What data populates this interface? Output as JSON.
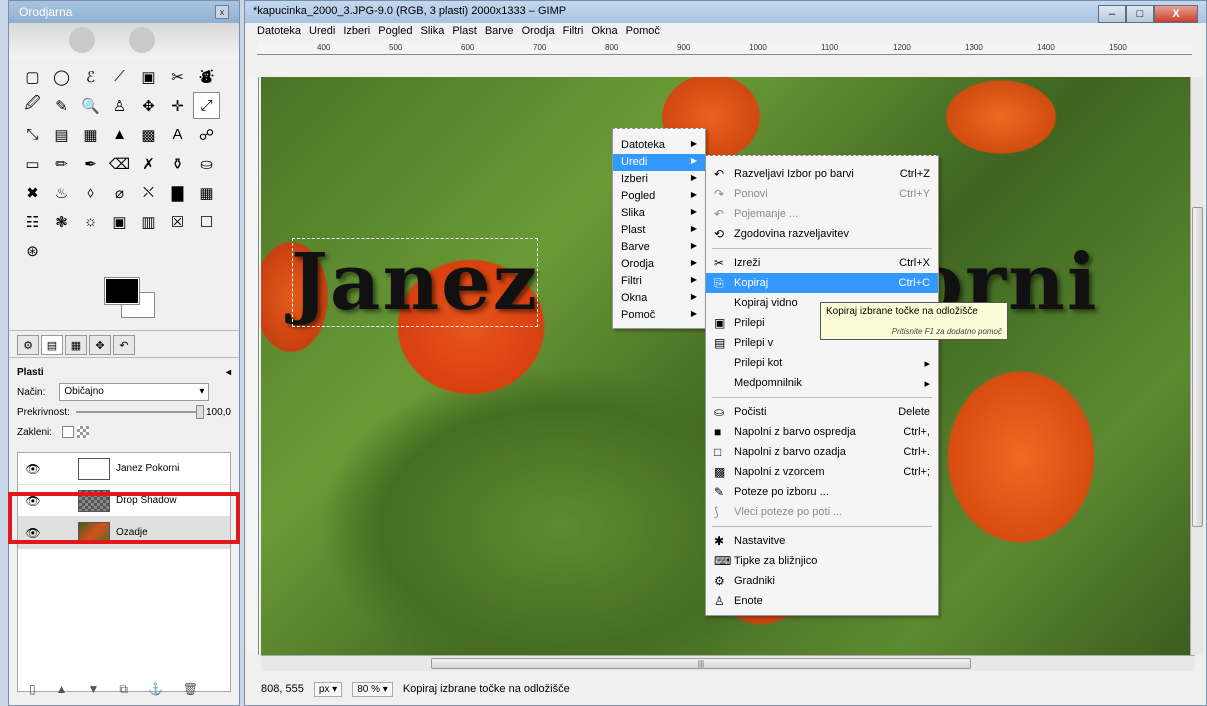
{
  "toolbox": {
    "title": "Orodjarna",
    "close_label": "x",
    "tools": [
      "▢",
      "◯",
      "ℰ",
      "⟋",
      "▣",
      "✂",
      "⛇",
      "🖉",
      "✎",
      "🔍",
      "♙",
      "✥",
      "✛",
      "⤢",
      "⤡",
      "▤",
      "▦",
      "▲",
      "▩",
      "A",
      "☍",
      "▭",
      "✏",
      "✒",
      "⌫",
      "✗",
      "⚱",
      "⛀",
      "✖",
      "♨",
      "⬨",
      "⌀",
      "⛌",
      "▇",
      "▦",
      "☷",
      "❃",
      "☼",
      "▣",
      "▥",
      "☒",
      "☐",
      "⊛"
    ],
    "layers_panel": {
      "title": "Plasti",
      "mode_label": "Način:",
      "mode_value": "Običajno",
      "opacity_label": "Prekrivnost:",
      "opacity_value": "100,0",
      "lock_label": "Zakleni:",
      "layers": [
        {
          "name": "Janez Pokorni"
        },
        {
          "name": "Drop Shadow"
        },
        {
          "name": "Ozadje"
        }
      ]
    }
  },
  "window": {
    "title": "*kapucinka_2000_3.JPG-9.0 (RGB, 3 plasti) 2000x1333 – GIMP",
    "minimize": "–",
    "maximize": "□",
    "close": "X"
  },
  "menubar": [
    "Datoteka",
    "Uredi",
    "Izberi",
    "Pogled",
    "Slika",
    "Plast",
    "Barve",
    "Orodja",
    "Filtri",
    "Okna",
    "Pomoč"
  ],
  "ruler_ticks": [
    "400",
    "500",
    "600",
    "700",
    "800",
    "900",
    "1000",
    "1100",
    "1200",
    "1300",
    "1400",
    "1500"
  ],
  "canvas": {
    "text_left": "Janez",
    "text_right": "orni"
  },
  "context_menu": {
    "items": [
      "Datoteka",
      "Uredi",
      "Izberi",
      "Pogled",
      "Slika",
      "Plast",
      "Barve",
      "Orodja",
      "Filtri",
      "Okna",
      "Pomoč"
    ],
    "highlighted": "Uredi"
  },
  "edit_menu": {
    "items": [
      {
        "icon": "undo-icon",
        "glyph": "↶",
        "label": "Razveljavi Izbor po barvi",
        "shortcut": "Ctrl+Z",
        "state": "normal"
      },
      {
        "icon": "redo-icon",
        "glyph": "↷",
        "label": "Ponovi",
        "shortcut": "Ctrl+Y",
        "state": "disabled"
      },
      {
        "icon": "fade-icon",
        "glyph": "↶",
        "label": "Pojemanje ...",
        "shortcut": "",
        "state": "disabled"
      },
      {
        "icon": "history-icon",
        "glyph": "⟲",
        "label": "Zgodovina razveljavitev",
        "shortcut": "",
        "state": "normal"
      },
      {
        "sep": true
      },
      {
        "icon": "cut-icon",
        "glyph": "✂",
        "label": "Izreži",
        "shortcut": "Ctrl+X",
        "state": "normal"
      },
      {
        "icon": "copy-icon",
        "glyph": "⎘",
        "label": "Kopiraj",
        "shortcut": "Ctrl+C",
        "state": "highlighted"
      },
      {
        "icon": "",
        "glyph": "",
        "label": "Kopiraj vidno",
        "shortcut": "",
        "state": "normal"
      },
      {
        "icon": "paste-icon",
        "glyph": "▣",
        "label": "Prilepi",
        "shortcut": "",
        "state": "normal"
      },
      {
        "icon": "paste-into-icon",
        "glyph": "▤",
        "label": "Prilepi v",
        "shortcut": "",
        "state": "normal"
      },
      {
        "icon": "",
        "glyph": "",
        "label": "Prilepi kot",
        "shortcut": "▸",
        "state": "normal"
      },
      {
        "icon": "",
        "glyph": "",
        "label": "Medpomnilnik",
        "shortcut": "▸",
        "state": "normal"
      },
      {
        "sep": true
      },
      {
        "icon": "clear-icon",
        "glyph": "⛀",
        "label": "Počisti",
        "shortcut": "Delete",
        "state": "normal"
      },
      {
        "icon": "fill-fg-icon",
        "glyph": "■",
        "label": "Napolni z barvo ospredja",
        "shortcut": "Ctrl+,",
        "state": "normal"
      },
      {
        "icon": "fill-bg-icon",
        "glyph": "□",
        "label": "Napolni z barvo ozadja",
        "shortcut": "Ctrl+.",
        "state": "normal"
      },
      {
        "icon": "fill-pattern-icon",
        "glyph": "▩",
        "label": "Napolni z vzorcem",
        "shortcut": "Ctrl+;",
        "state": "normal"
      },
      {
        "icon": "stroke-selection-icon",
        "glyph": "✎",
        "label": "Poteze po izboru ...",
        "shortcut": "",
        "state": "normal"
      },
      {
        "icon": "stroke-path-icon",
        "glyph": "⟆",
        "label": "Vleci poteze po poti ...",
        "shortcut": "",
        "state": "disabled"
      },
      {
        "sep": true
      },
      {
        "icon": "preferences-icon",
        "glyph": "✱",
        "label": "Nastavitve",
        "shortcut": "",
        "state": "normal"
      },
      {
        "icon": "keyboard-icon",
        "glyph": "⌨",
        "label": "Tipke za bližnjico",
        "shortcut": "",
        "state": "normal"
      },
      {
        "icon": "modules-icon",
        "glyph": "⚙",
        "label": "Gradniki",
        "shortcut": "",
        "state": "normal"
      },
      {
        "icon": "units-icon",
        "glyph": "♙",
        "label": "Enote",
        "shortcut": "",
        "state": "normal"
      }
    ]
  },
  "tooltip": {
    "text": "Kopiraj izbrane točke na odložišče",
    "hint": "Pritisnite F1 za dodatno pomoč"
  },
  "statusbar": {
    "coords": "808, 555",
    "unit": "px",
    "zoom": "80 %",
    "message": "Kopiraj izbrane točke na odložišče"
  },
  "colors": {
    "highlight": "#3399ff",
    "annotation_box": "#e01818"
  }
}
